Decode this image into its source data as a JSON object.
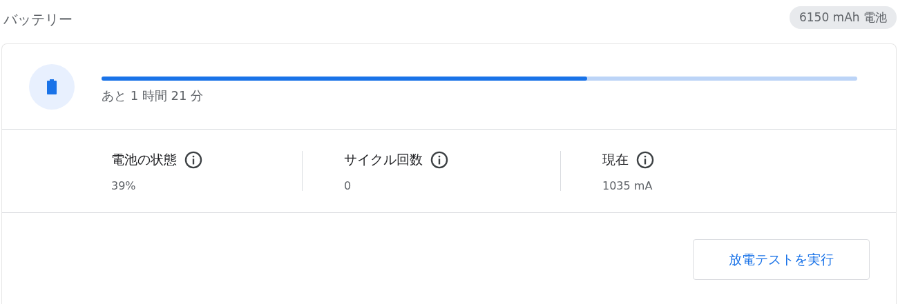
{
  "header": {
    "title": "バッテリー",
    "badge": "6150 mAh 電池"
  },
  "status": {
    "level": 0.643,
    "remaining": "あと 1 時間 21 分"
  },
  "stats": [
    {
      "label": "電池の状態",
      "value": "39%"
    },
    {
      "label": "サイクル回数",
      "value": "0"
    },
    {
      "label": "現在",
      "value": "1035 mA"
    }
  ],
  "actions": {
    "button": "放電テストを実行"
  }
}
